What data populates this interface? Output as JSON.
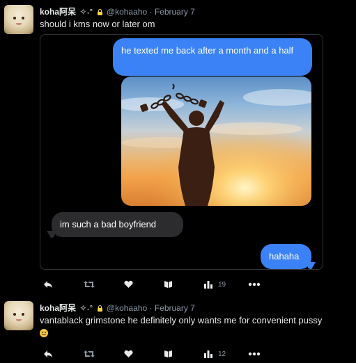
{
  "tweets": [
    {
      "author_name": "koha阿呆",
      "author_badges": "✧˖°",
      "handle": "@kohaaho",
      "separator": "·",
      "date": "February 7",
      "text": "should i kms now or later om",
      "media": {
        "messages": [
          {
            "side": "right",
            "color": "blue",
            "text": "he texted me back after a month and a half"
          },
          {
            "side": "right",
            "type": "image",
            "description_icon": "silhouette-breaking-chains"
          },
          {
            "side": "left",
            "color": "gray",
            "text": "im such a bad boyfriend"
          },
          {
            "side": "right",
            "color": "blue",
            "text": "hahaha"
          }
        ]
      },
      "actions": {
        "views_count": "19"
      }
    },
    {
      "author_name": "koha阿呆",
      "author_badges": "✧˖°",
      "handle": "@kohaaho",
      "separator": "·",
      "date": "February 7",
      "text": "vantablack grimstone he definitely only wants me for convenient pussy",
      "emoji": "neutral-face-emoji",
      "actions": {
        "views_count": "12"
      }
    }
  ],
  "colors": {
    "background": "#000000",
    "text": "#e7e9ea",
    "muted": "#8b98a5",
    "imessage_blue": "#3b82f6",
    "imessage_gray": "#2c2c2e",
    "lock": "#f5d442"
  }
}
